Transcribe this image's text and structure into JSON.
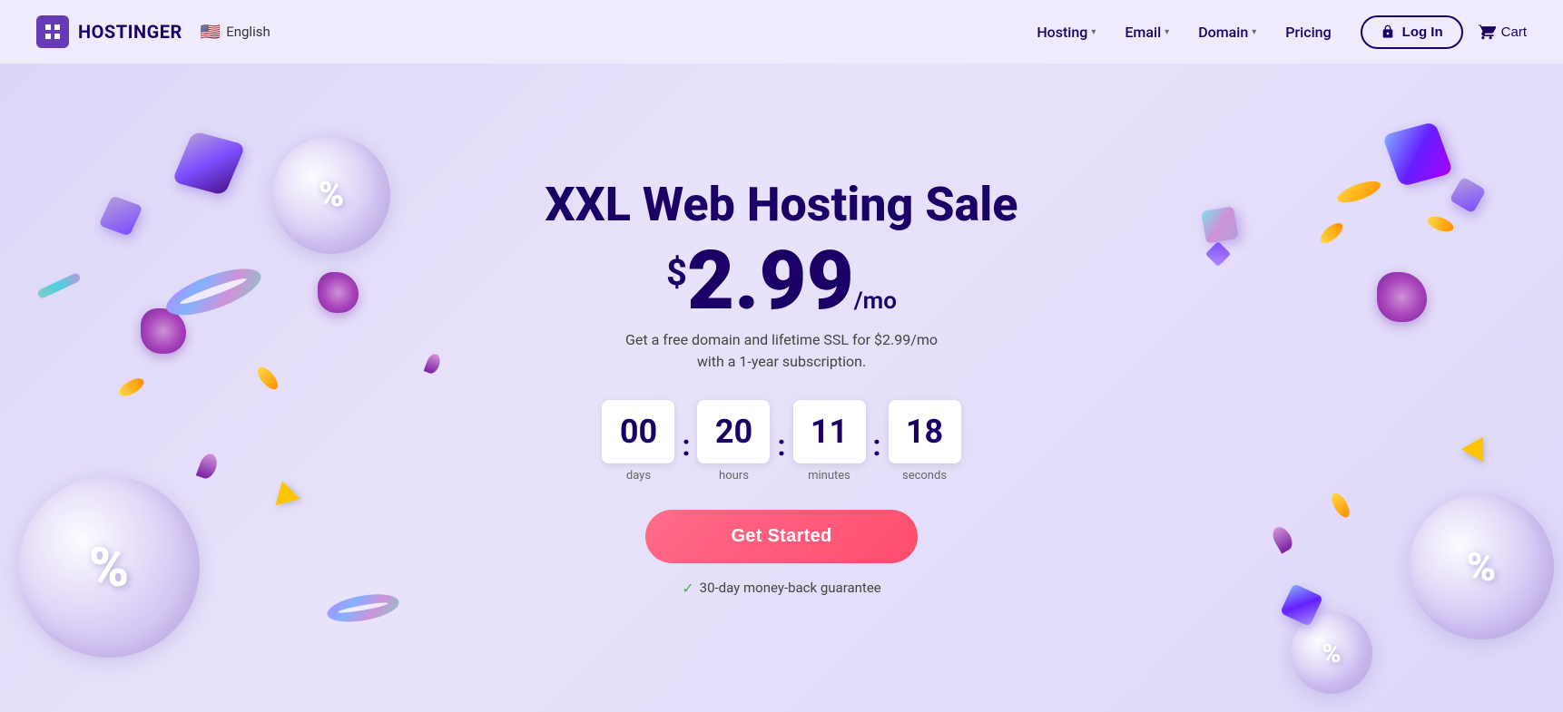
{
  "navbar": {
    "logo_text": "HOSTINGER",
    "lang_flag": "🇺🇸",
    "lang_label": "English",
    "nav_items": [
      {
        "label": "Hosting",
        "has_dropdown": true
      },
      {
        "label": "Email",
        "has_dropdown": true
      },
      {
        "label": "Domain",
        "has_dropdown": true
      },
      {
        "label": "Pricing",
        "has_dropdown": false
      }
    ],
    "login_label": "Log In",
    "cart_label": "Cart"
  },
  "hero": {
    "title": "XXL Web Hosting Sale",
    "price_symbol": "$",
    "price_value": "2.99",
    "price_period": "/mo",
    "subtitle_line1": "Get a free domain and lifetime SSL for $2.99/mo",
    "subtitle_line2": "with a 1-year subscription.",
    "cta_label": "Get Started",
    "guarantee_label": "30-day money-back guarantee"
  },
  "countdown": {
    "days_value": "00",
    "days_label": "days",
    "hours_value": "20",
    "hours_label": "hours",
    "minutes_value": "11",
    "minutes_label": "minutes",
    "seconds_value": "18",
    "seconds_label": "seconds"
  },
  "colors": {
    "accent_dark": "#1a0066",
    "cta_pink": "#ff4d6d",
    "bg_lavender": "#e8e0f8",
    "guarantee_green": "#4caf50"
  }
}
